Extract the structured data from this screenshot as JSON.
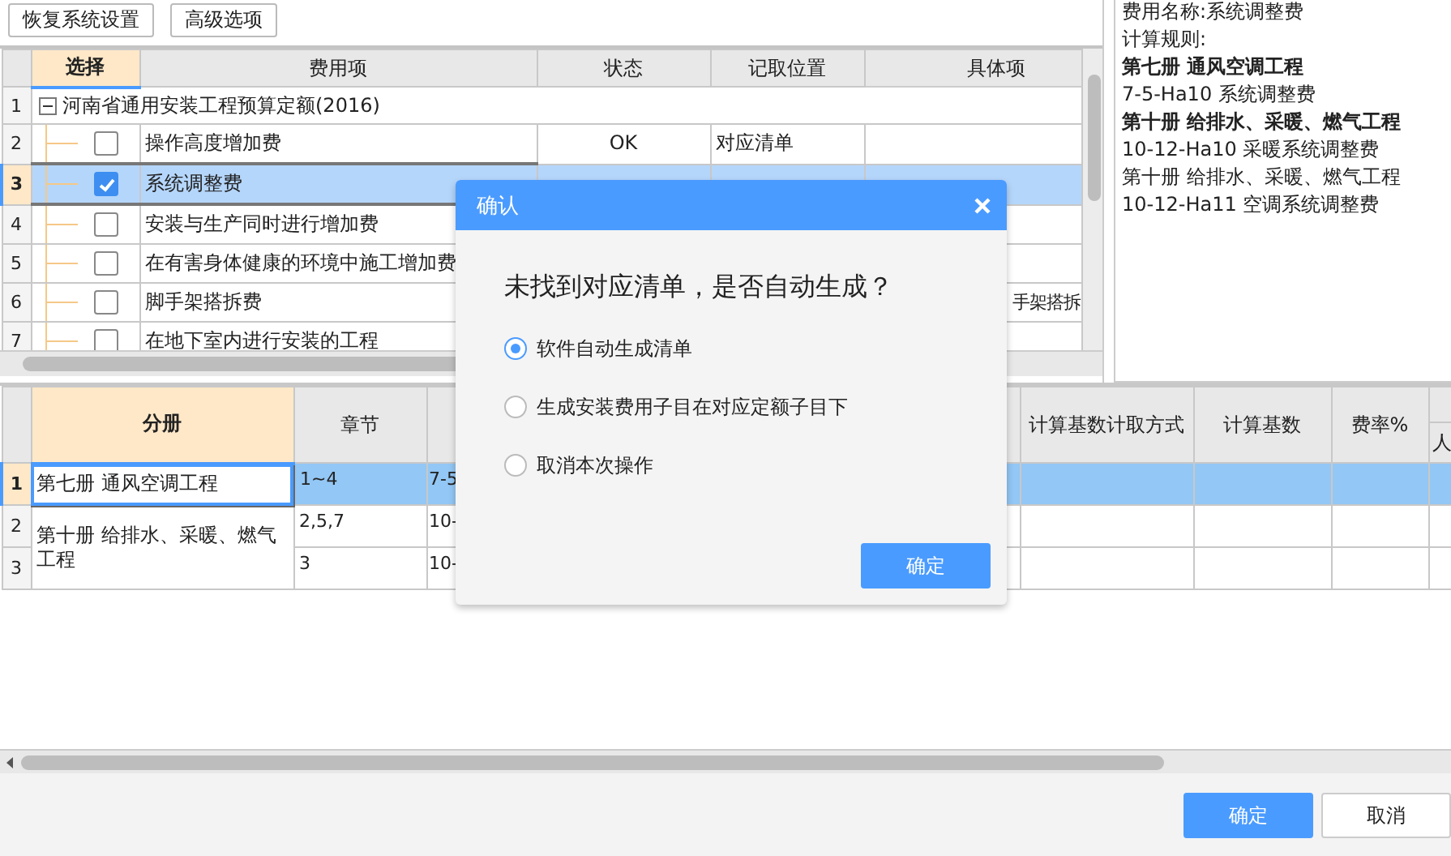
{
  "toolbar": {
    "buttons": [
      "恢复系统设置",
      "高级选项"
    ]
  },
  "fee_table": {
    "columns": [
      "选择",
      "费用项",
      "状态",
      "记取位置",
      "具体项"
    ],
    "root": {
      "index": "1",
      "label": "河南省通用安装工程预算定额(2016)",
      "expanded": true,
      "children": [
        {
          "index": "2",
          "name": "操作高度增加费",
          "checked": false,
          "selected": false,
          "status": "OK",
          "position": "对应清单"
        },
        {
          "index": "3",
          "name": "系统调整费",
          "checked": true,
          "selected": true
        },
        {
          "index": "4",
          "name": "安装与生产同时进行增加费",
          "checked": false,
          "selected": false
        },
        {
          "index": "5",
          "name": "在有害身体健康的环境中施工增加费",
          "checked": false,
          "selected": false
        },
        {
          "index": "6",
          "name": "脚手架搭拆费",
          "checked": false,
          "selected": false,
          "detail": "手架搭拆"
        },
        {
          "index": "7",
          "name": "在地下室内进行安装的工程",
          "checked": false,
          "selected": false
        }
      ]
    }
  },
  "info_panel": {
    "lines": [
      {
        "text": "费用名称:系统调整费",
        "bold": false
      },
      {
        "text": "计算规则:",
        "bold": false
      },
      {
        "text": "第七册 通风空调工程",
        "bold": true
      },
      {
        "text": "7-5-Ha10 系统调整费",
        "bold": false
      },
      {
        "text": "第十册 给排水、采暖、燃气工程",
        "bold": true
      },
      {
        "text": "10-12-Ha10 采暖系统调整费",
        "bold": false
      },
      {
        "text": "第十册 给排水、采暖、燃气工程",
        "bold": false
      },
      {
        "text": "10-12-Ha11 空调系统调整费",
        "bold": false
      }
    ]
  },
  "volume_table": {
    "columns": [
      "分册",
      "章节",
      null,
      "计算基数计取方式",
      "计算基数",
      "费率%"
    ],
    "sub_header": "人",
    "groups": [
      {
        "volume": "第七册  通风空调工程",
        "selected": true,
        "rows": [
          {
            "index": "1",
            "chapter": "1~4",
            "column_3": "7-5"
          }
        ]
      },
      {
        "volume": "第十册  给排水、采暖、燃气工程",
        "selected": false,
        "rows": [
          {
            "index": "2",
            "chapter": "2,5,7",
            "column_3": "10-"
          },
          {
            "index": "3",
            "chapter": "3",
            "column_3": "10-"
          }
        ]
      }
    ]
  },
  "dialog": {
    "title": "确认",
    "question": "未找到对应清单，是否自动生成？",
    "options": [
      {
        "label": "软件自动生成清单",
        "selected": true
      },
      {
        "label": "生成安装费用子目在对应定额子目下",
        "selected": false
      },
      {
        "label": "取消本次操作",
        "selected": false
      }
    ],
    "button": "确定"
  },
  "footer": {
    "buttons": [
      {
        "label": "确定",
        "kind": "primary"
      },
      {
        "label": "取消",
        "kind": "default"
      }
    ]
  }
}
